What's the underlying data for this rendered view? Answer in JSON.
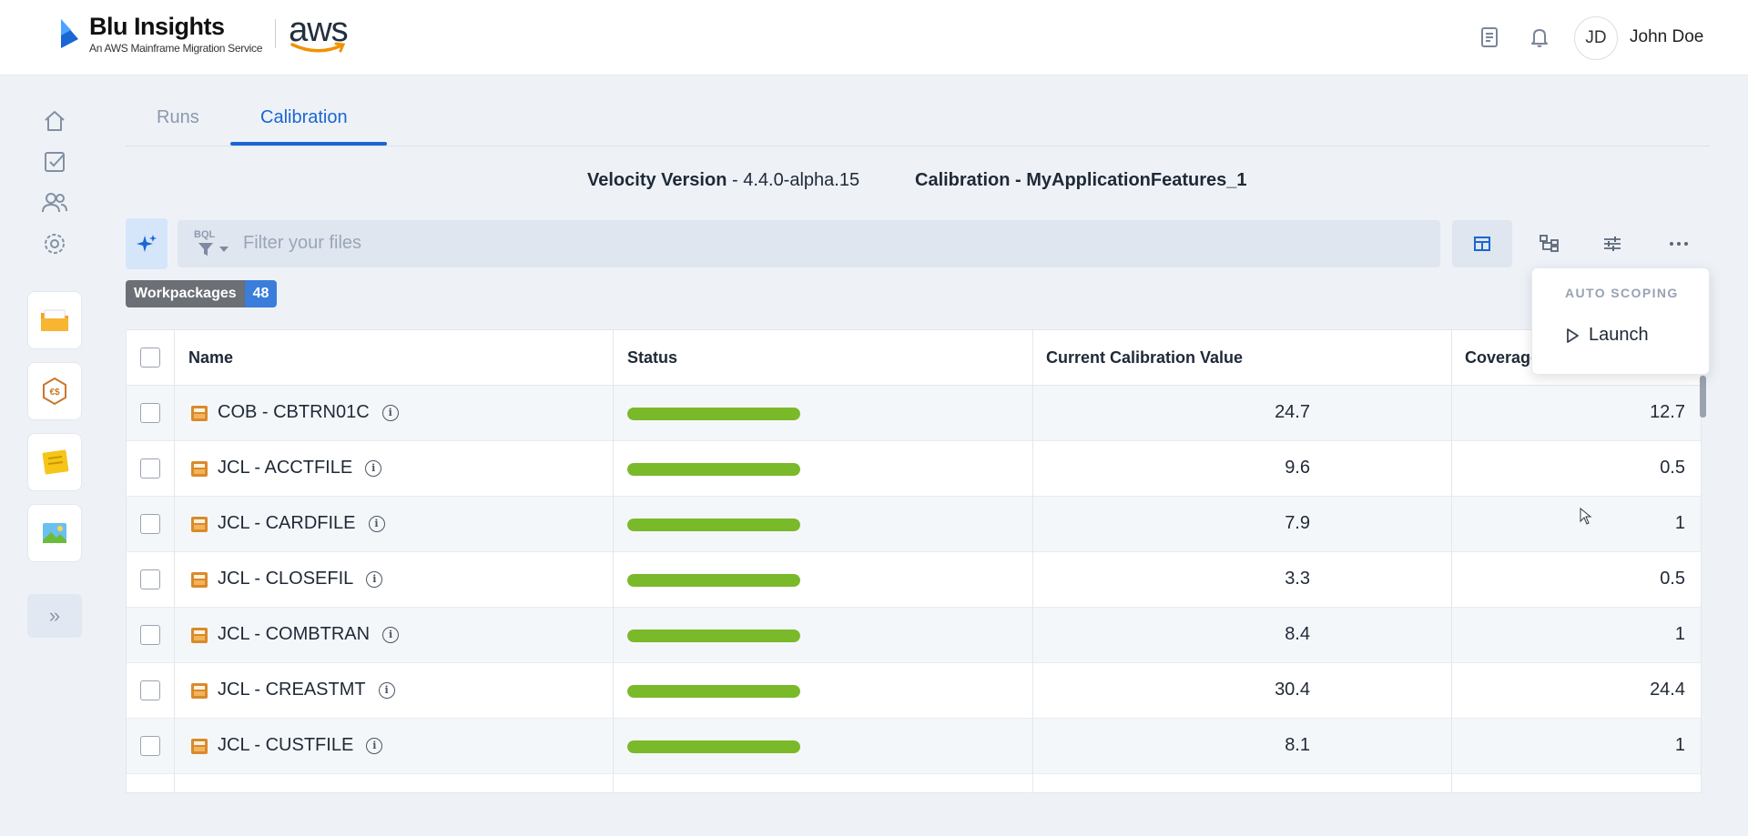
{
  "brand": {
    "title": "Blu Insights",
    "subtitle": "An AWS Mainframe Migration Service",
    "partner": "aws"
  },
  "header": {
    "icons": [
      "docs-icon",
      "bell-icon"
    ],
    "user_initials": "JD",
    "user_name": "John Doe"
  },
  "left_nav": {
    "items": [
      "home-icon",
      "tasks-icon",
      "team-icon",
      "settings-icon"
    ],
    "apps": [
      "codebase-app-icon",
      "transformation-center-app-icon",
      "notes-app-icon",
      "gallery-app-icon"
    ],
    "expand_label": "»"
  },
  "tabs": [
    {
      "label": "Runs",
      "active": false
    },
    {
      "label": "Calibration",
      "active": true
    }
  ],
  "info": {
    "velocity_label": "Velocity Version",
    "velocity_sep": " - ",
    "velocity_value": "4.4.0-alpha.15",
    "calibration_label": "Calibration - MyApplicationFeatures_1"
  },
  "filter": {
    "bql_label": "BQL",
    "placeholder": "Filter your files"
  },
  "view_buttons": [
    "table-view-icon",
    "tree-view-icon",
    "settings-sliders-icon",
    "more-icon"
  ],
  "workpackages": {
    "label": "Workpackages",
    "count": "48"
  },
  "table": {
    "columns": [
      "Name",
      "Status",
      "Current Calibration Value",
      "Coverage"
    ],
    "rows": [
      {
        "name": "COB - CBTRN01C",
        "status_progress": 1.0,
        "calibration": "24.7",
        "coverage": "12.7"
      },
      {
        "name": "JCL - ACCTFILE",
        "status_progress": 1.0,
        "calibration": "9.6",
        "coverage": "0.5"
      },
      {
        "name": "JCL - CARDFILE",
        "status_progress": 1.0,
        "calibration": "7.9",
        "coverage": "1"
      },
      {
        "name": "JCL - CLOSEFIL",
        "status_progress": 1.0,
        "calibration": "3.3",
        "coverage": "0.5"
      },
      {
        "name": "JCL - COMBTRAN",
        "status_progress": 1.0,
        "calibration": "8.4",
        "coverage": "1"
      },
      {
        "name": "JCL - CREASTMT",
        "status_progress": 1.0,
        "calibration": "30.4",
        "coverage": "24.4"
      },
      {
        "name": "JCL - CUSTFILE",
        "status_progress": 1.0,
        "calibration": "8.1",
        "coverage": "1"
      }
    ]
  },
  "dropdown": {
    "header": "AUTO SCOPING",
    "item": "Launch"
  },
  "colors": {
    "accent": "#1a66d2",
    "status_ok": "#7ab929",
    "badge_count": "#3b7ddb"
  }
}
